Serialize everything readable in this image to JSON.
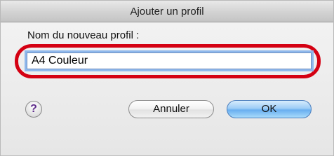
{
  "dialog": {
    "title": "Ajouter un profil",
    "field_label": "Nom du nouveau profil :",
    "field_value": "A4 Couleur",
    "help_label": "?",
    "cancel_label": "Annuler",
    "ok_label": "OK"
  },
  "colors": {
    "highlight_ring": "#d40012",
    "focus_ring": "#8fb8ec",
    "default_button": "#69aff0"
  }
}
